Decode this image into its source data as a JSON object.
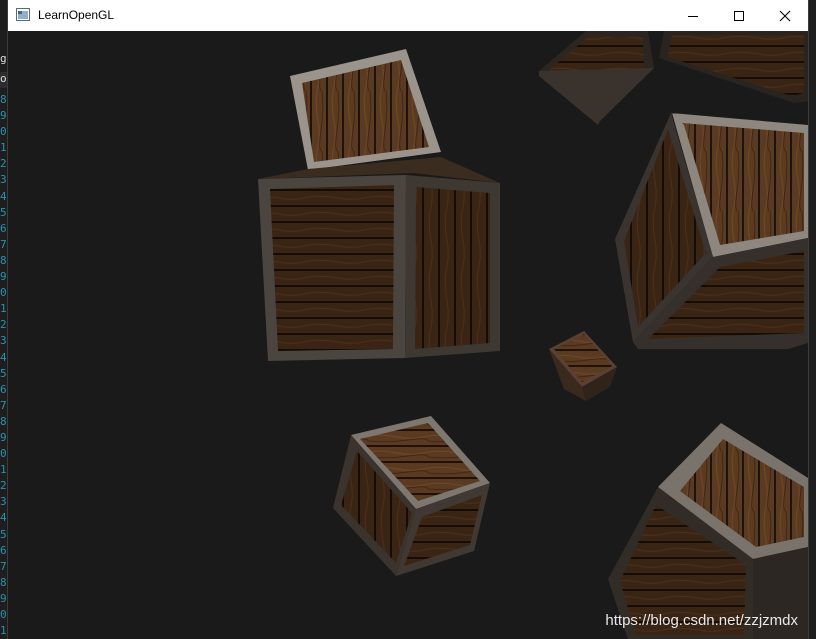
{
  "window": {
    "title": "LearnOpenGL",
    "controls": {
      "minimize_icon": "minimize-icon",
      "maximize_icon": "maximize-icon",
      "close_icon": "close-icon"
    }
  },
  "editor": {
    "top_left_1": "g",
    "top_left_2": "o",
    "line_digits": [
      "8",
      "9",
      "0",
      "1",
      "2",
      "3",
      "4",
      "5",
      "6",
      "7",
      "8",
      "9",
      "0",
      "1",
      "2",
      "3",
      "4",
      "5",
      "6",
      "7",
      "8",
      "9",
      "0",
      "1",
      "2",
      "3",
      "4",
      "5",
      "6",
      "7",
      "8",
      "9",
      "0",
      "1"
    ]
  },
  "scene": {
    "object": "wooden-crate-cubes",
    "background_color": "#1a1a1a",
    "crate_wood": "#5a3a22",
    "crate_frame": "#8a8580"
  },
  "watermark": "https://blog.csdn.net/zzjzmdx"
}
